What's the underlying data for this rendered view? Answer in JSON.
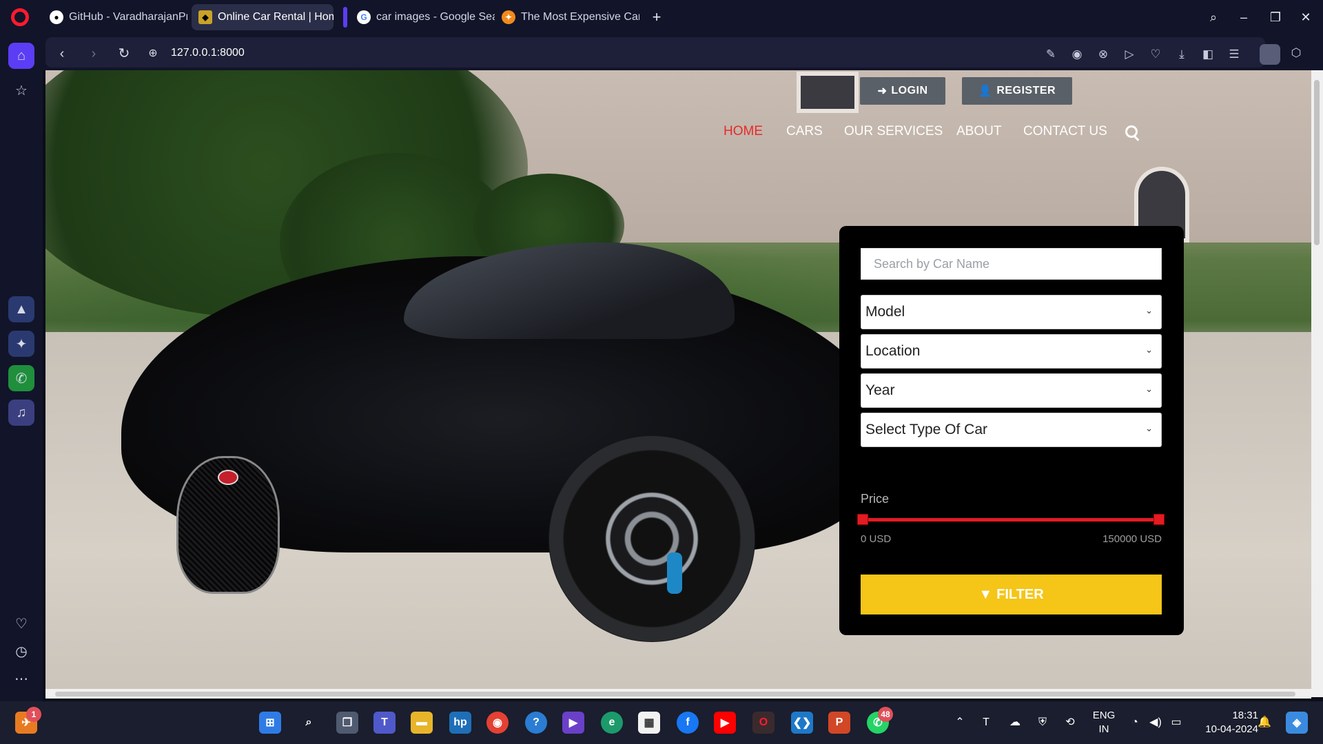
{
  "browser": {
    "tabs": [
      {
        "label": "GitHub - VaradharajanProj",
        "icon": "github-icon",
        "active": false
      },
      {
        "label": "Online Car Rental | Home",
        "icon": "site-favicon",
        "active": true
      },
      {
        "label": "car images - Google Searc",
        "icon": "google-icon",
        "active": false
      },
      {
        "label": "The Most Expensive Car In",
        "icon": "site-favicon-orange",
        "active": false
      }
    ],
    "url": "127.0.0.1:8000"
  },
  "site": {
    "auth": {
      "login": "LOGIN",
      "register": "REGISTER"
    },
    "nav": [
      "HOME",
      "CARS",
      "OUR SERVICES",
      "ABOUT",
      "CONTACT US"
    ],
    "active_nav": "HOME",
    "filter": {
      "search_placeholder": "Search by Car Name",
      "selects": [
        "Model",
        "Location",
        "Year",
        "Select Type Of Car"
      ],
      "price_label": "Price",
      "price_min": "0 USD",
      "price_max": "150000 USD",
      "price_range": [
        0,
        150000
      ],
      "button": "FILTER"
    },
    "colors": {
      "accent_red": "#e31b23",
      "filter_yellow": "#f5c518"
    }
  },
  "taskbar": {
    "opera_badge": "1",
    "whatsapp_badge": "48",
    "language": "ENG",
    "region": "IN",
    "time": "18:31",
    "date": "10-04-2024"
  }
}
